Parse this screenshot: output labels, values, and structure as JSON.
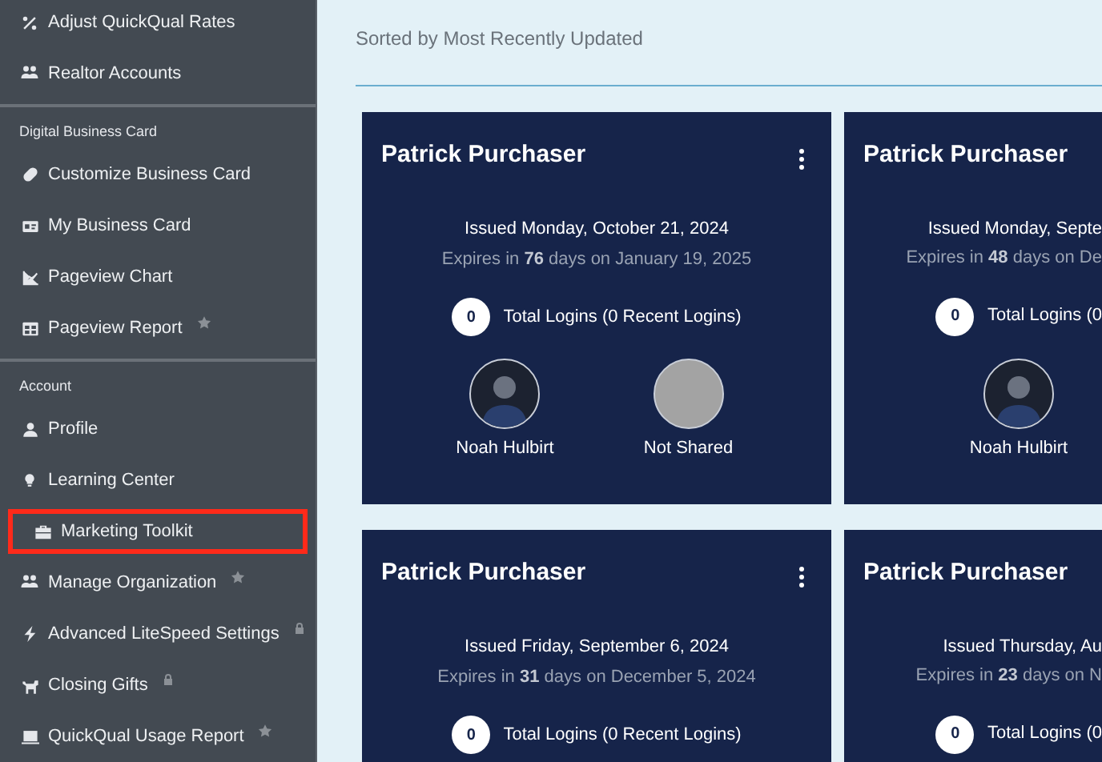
{
  "sidebar": {
    "sections": [
      {
        "items": [
          {
            "label": "Adjust QuickQual Rates",
            "highlighted": false,
            "starred": false,
            "locked": false
          },
          {
            "label": "Realtor Accounts",
            "highlighted": false,
            "starred": false,
            "locked": false
          }
        ]
      },
      {
        "heading": "Digital Business Card",
        "items": [
          {
            "label": "Customize Business Card",
            "highlighted": false,
            "starred": false,
            "locked": false
          },
          {
            "label": "My Business Card",
            "highlighted": false,
            "starred": false,
            "locked": false
          },
          {
            "label": "Pageview Chart",
            "highlighted": false,
            "starred": false,
            "locked": false
          },
          {
            "label": "Pageview Report",
            "highlighted": false,
            "starred": true,
            "locked": false
          }
        ]
      },
      {
        "heading": "Account",
        "items": [
          {
            "label": "Profile",
            "highlighted": false,
            "starred": false,
            "locked": false
          },
          {
            "label": "Learning Center",
            "highlighted": false,
            "starred": false,
            "locked": false
          },
          {
            "label": "Marketing Toolkit",
            "highlighted": true,
            "starred": false,
            "locked": false
          },
          {
            "label": "Manage Organization",
            "highlighted": false,
            "starred": true,
            "locked": false
          },
          {
            "label": "Advanced LiteSpeed Settings",
            "highlighted": false,
            "starred": false,
            "locked": true
          },
          {
            "label": "Closing Gifts",
            "highlighted": false,
            "starred": false,
            "locked": true
          },
          {
            "label": "QuickQual Usage Report",
            "highlighted": false,
            "starred": true,
            "locked": false
          }
        ]
      }
    ]
  },
  "page": {
    "subtitle": "Sorted by Most Recently Updated"
  },
  "cards": [
    {
      "kind": "full",
      "name": "Patrick Purchaser",
      "issued": "Issued Monday, October 21, 2024",
      "expires": "Expires in **76** days on January 19, 2025",
      "logins_count": "0",
      "logins": "Total Logins (0 Recent Logins)",
      "people": [
        {
          "kind": "photo",
          "name": "Noah Hulbirt"
        },
        {
          "kind": "none",
          "name": "Not Shared"
        }
      ]
    },
    {
      "kind": "cut",
      "name": "Patrick Purchaser",
      "issued": "Issued Monday, Septe",
      "expires": "Expires in **48** days on De",
      "logins_count": "0",
      "logins": "Total Logins (0",
      "people": [
        {
          "kind": "photo",
          "name": "Noah Hulbirt"
        }
      ]
    },
    {
      "kind": "full",
      "name": "Patrick Purchaser",
      "issued": "Issued Friday, September 6, 2024",
      "expires": "Expires in **31** days on December 5, 2024",
      "logins_count": "0",
      "logins": "Total Logins (0 Recent Logins)"
    },
    {
      "kind": "cut",
      "name": "Patrick Purchaser",
      "issued": "Issued Thursday, Au",
      "expires": "Expires in **23** days on N",
      "logins_count": "0",
      "logins": "Total Logins (0"
    }
  ]
}
